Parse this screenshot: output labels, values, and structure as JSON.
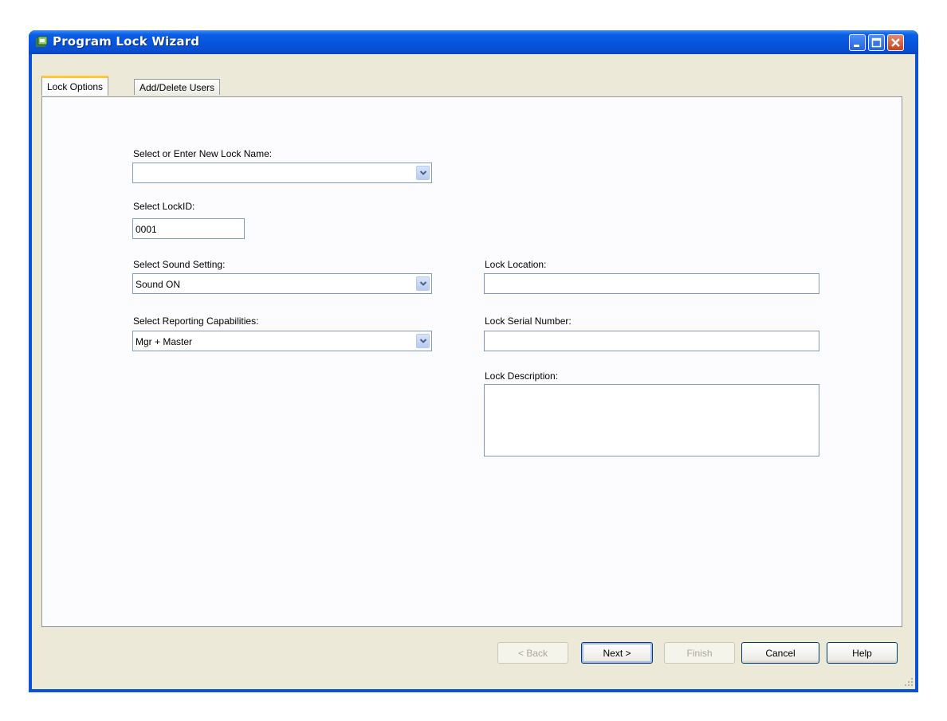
{
  "window": {
    "title": "Program Lock Wizard"
  },
  "tabs": [
    {
      "label": "Lock Options",
      "active": true
    },
    {
      "label": "Add/Delete Users",
      "active": false
    }
  ],
  "form": {
    "lock_name": {
      "label": "Select or Enter New Lock Name:",
      "value": ""
    },
    "lock_id": {
      "label": "Select LockID:",
      "value": "0001"
    },
    "sound": {
      "label": "Select Sound Setting:",
      "value": "Sound ON"
    },
    "reporting": {
      "label": "Select Reporting Capabilities:",
      "value": "Mgr + Master"
    },
    "location": {
      "label": "Lock Location:",
      "value": ""
    },
    "serial": {
      "label": "Lock Serial Number:",
      "value": ""
    },
    "description": {
      "label": "Lock Description:",
      "value": ""
    }
  },
  "buttons": {
    "back": "< Back",
    "next": "Next >",
    "finish": "Finish",
    "cancel": "Cancel",
    "help": "Help"
  },
  "colors": {
    "title_bar": "#0654dd",
    "dialog_face": "#ece9d8",
    "active_tab_highlight": "#ffc83c"
  }
}
